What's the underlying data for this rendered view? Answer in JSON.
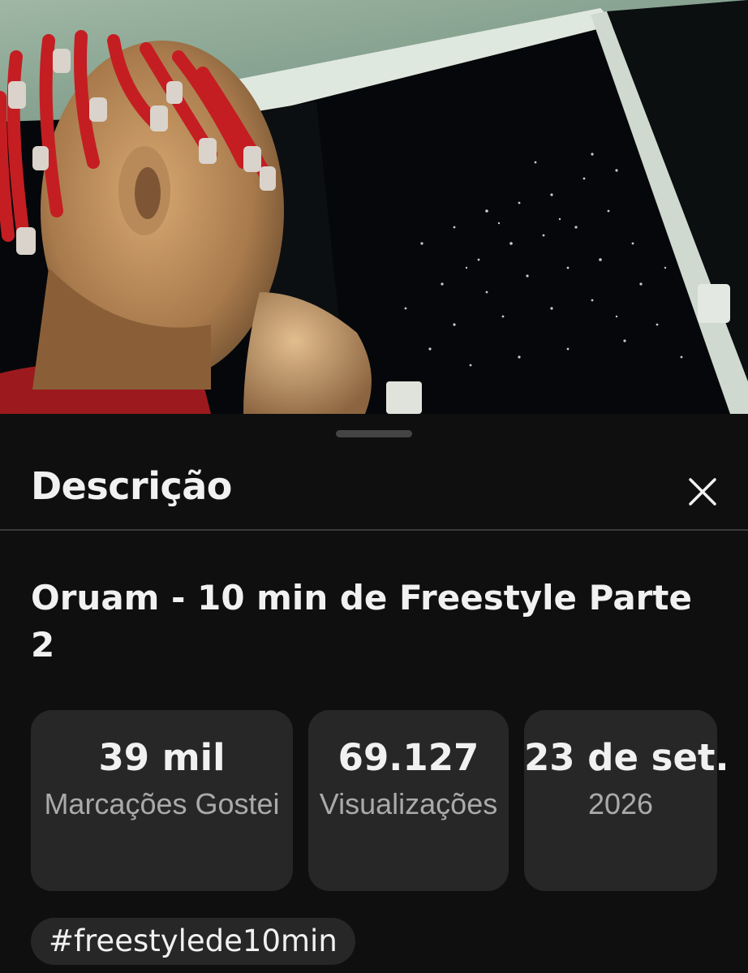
{
  "video": {
    "thumbnail_description_icon": "video-frame"
  },
  "sheet": {
    "title": "Descrição",
    "close_icon": "close-icon"
  },
  "video_title": "Oruam - 10 min de Freestyle Parte 2",
  "stats": {
    "likes": {
      "value": "39 mil",
      "label": "Marcações Gostei"
    },
    "views": {
      "value": "69.127",
      "label": "Visualizações"
    },
    "date": {
      "value": "23 de set.",
      "label": "2026"
    }
  },
  "hashtags": [
    "#freestylede10min"
  ],
  "colors": {
    "background": "#0f0f0f",
    "card": "#272727",
    "text_primary": "#f1f1f1",
    "text_secondary": "#aaaaaa"
  }
}
